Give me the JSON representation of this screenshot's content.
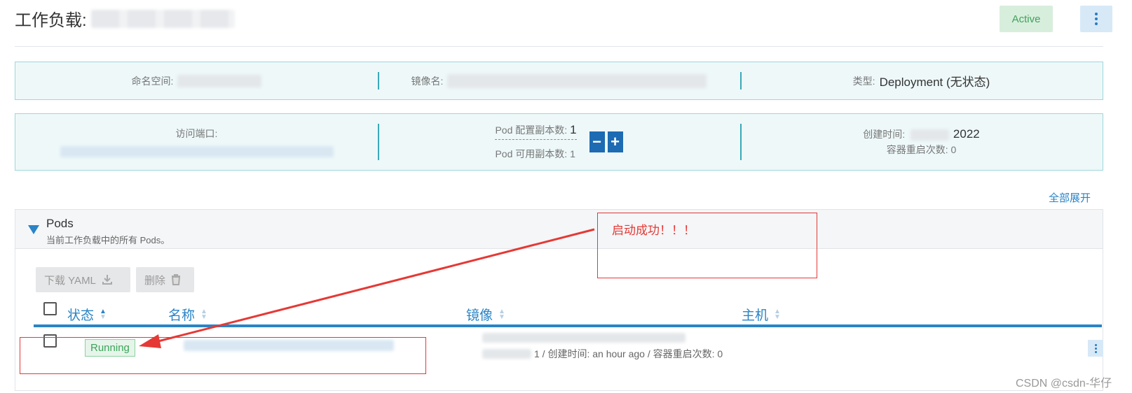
{
  "header": {
    "title_prefix": "工作负载:",
    "state": "Active",
    "menu_icon": "kebab-icon"
  },
  "info": {
    "namespace_label": "命名空间:",
    "image_label": "镜像名:",
    "type_label": "类型:",
    "type_value": "Deployment (无状态)",
    "endpoints_label": "访问端口:",
    "configured_label": "Pod 配置副本数:",
    "configured_value": "1",
    "available_label": "Pod 可用副本数:",
    "available_value": "1",
    "created_label": "创建时间:",
    "created_value": "2022",
    "restarts_label": "容器重启次数:",
    "restarts_value": "0"
  },
  "expand_all": "全部展开",
  "pods": {
    "title": "Pods",
    "subtitle": "当前工作负载中的所有 Pods。",
    "download_label": "下载 YAML",
    "delete_label": "删除",
    "columns": [
      "状态",
      "名称",
      "镜像",
      "主机"
    ],
    "rows": [
      {
        "state": "Running",
        "meta": "1 / 创建时间: an hour ago / 容器重启次数: 0"
      }
    ]
  },
  "annotation": {
    "text": "启动成功！！！",
    "color": "#e53935"
  },
  "watermark": "CSDN @csdn-华仔",
  "colors": {
    "accent": "#2a84c6",
    "success": "#3da35a",
    "info_bg": "#eef8f9"
  }
}
